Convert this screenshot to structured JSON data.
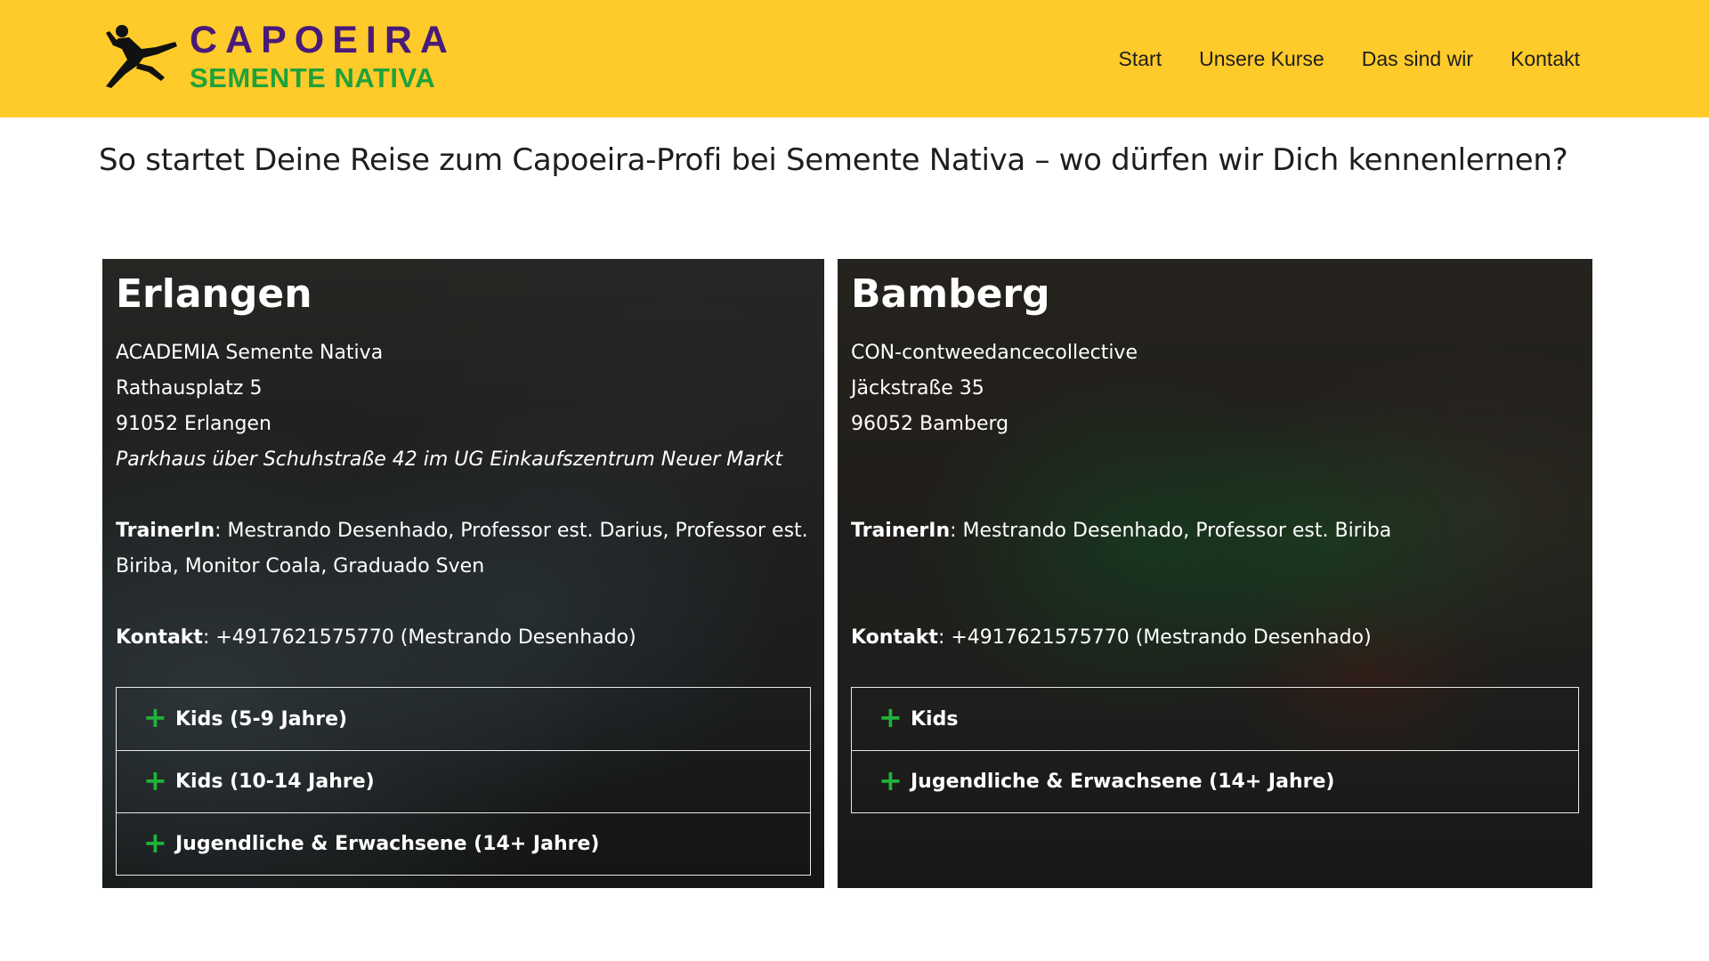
{
  "header": {
    "logo_line1": "CAPOEIRA",
    "logo_line2": "SEMENTE NATIVA",
    "logo_icon": "capoeira-kick-figure",
    "nav": [
      "Start",
      "Unsere Kurse",
      "Das sind wir",
      "Kontakt"
    ],
    "bg_color": "#ffcb2b"
  },
  "heading": "So startet Deine Reise zum Capoeira-Profi bei Semente Nativa – wo dürfen wir Dich kennenlernen?",
  "locations": [
    {
      "city": "Erlangen",
      "venue": "ACADEMIA Semente Nativa",
      "street": "Rathausplatz 5",
      "zip_city": "91052 Erlangen",
      "note": "Parkhaus über Schuhstraße 42 im UG Einkaufszentrum Neuer Markt",
      "trainer_label": "TrainerIn",
      "trainer_line1": ": Mestrando Desenhado, Professor est. Darius, Professor est.",
      "trainer_line2": "Biriba, Monitor Coala, Graduado Sven",
      "contact_label": "Kontakt",
      "contact_value": ": +4917621575770 (Mestrando Desenhado)",
      "courses": [
        "Kids (5-9 Jahre)",
        "Kids (10-14 Jahre)",
        "Jugendliche & Erwachsene (14+ Jahre)"
      ]
    },
    {
      "city": "Bamberg",
      "venue": "CON-contweedancecollective",
      "street": "Jäckstraße 35",
      "zip_city": "96052 Bamberg",
      "trainer_label": "TrainerIn",
      "trainer_line1": ": Mestrando Desenhado, Professor est. Biriba",
      "contact_label": "Kontakt",
      "contact_value": ": +4917621575770 (Mestrando Desenhado)",
      "courses": [
        "Kids",
        "Jugendliche & Erwachsene (14+ Jahre)"
      ]
    }
  ],
  "accordion_icon": "plus-icon",
  "accent_green": "#1fb33a",
  "logo_purple": "#4a1a7a"
}
